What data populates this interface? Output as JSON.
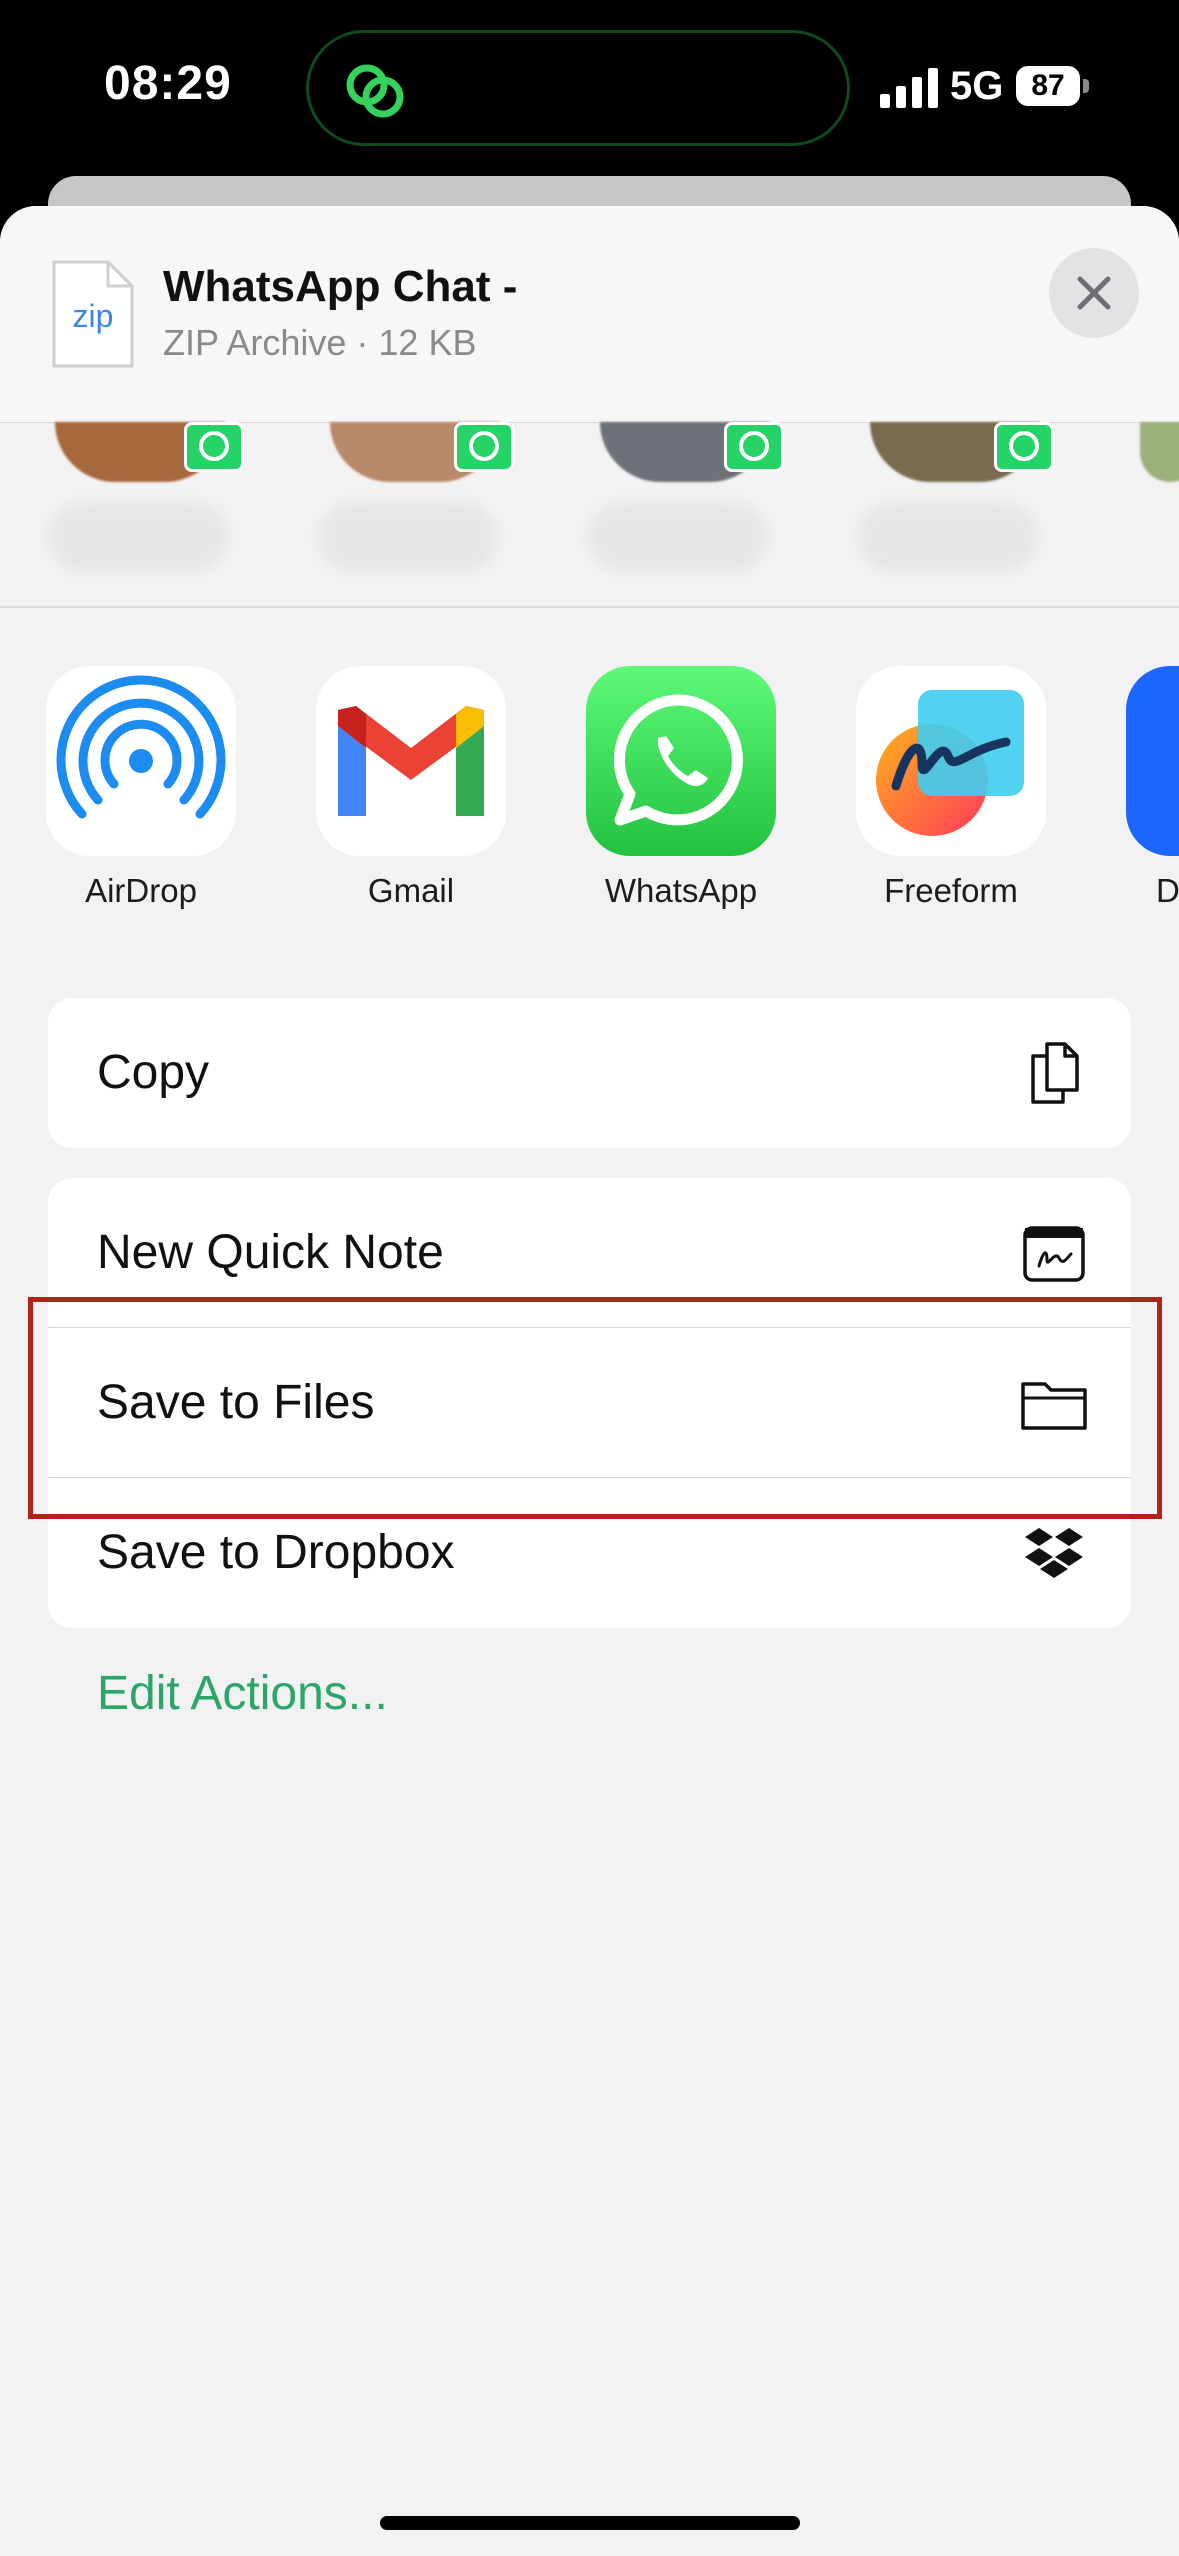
{
  "status_bar": {
    "time": "08:29",
    "network": "5G",
    "battery": "87"
  },
  "share_sheet": {
    "file_icon_label": "zip",
    "file_title": "WhatsApp Chat -",
    "file_subtitle": "ZIP Archive · 12 KB"
  },
  "apps": [
    {
      "label": "AirDrop",
      "icon": "airdrop-icon"
    },
    {
      "label": "Gmail",
      "icon": "gmail-icon"
    },
    {
      "label": "WhatsApp",
      "icon": "whatsapp-icon"
    },
    {
      "label": "Freeform",
      "icon": "freeform-icon"
    },
    {
      "label": "D",
      "icon": "app-icon-partial"
    }
  ],
  "actions": {
    "copy": "Copy",
    "new_quick_note": "New Quick Note",
    "save_to_files": "Save to Files",
    "save_to_dropbox": "Save to Dropbox",
    "edit_actions": "Edit Actions..."
  },
  "colors": {
    "accent_green": "#2ba66a",
    "whatsapp_green": "#25d366",
    "highlight_red": "#b0231b"
  }
}
